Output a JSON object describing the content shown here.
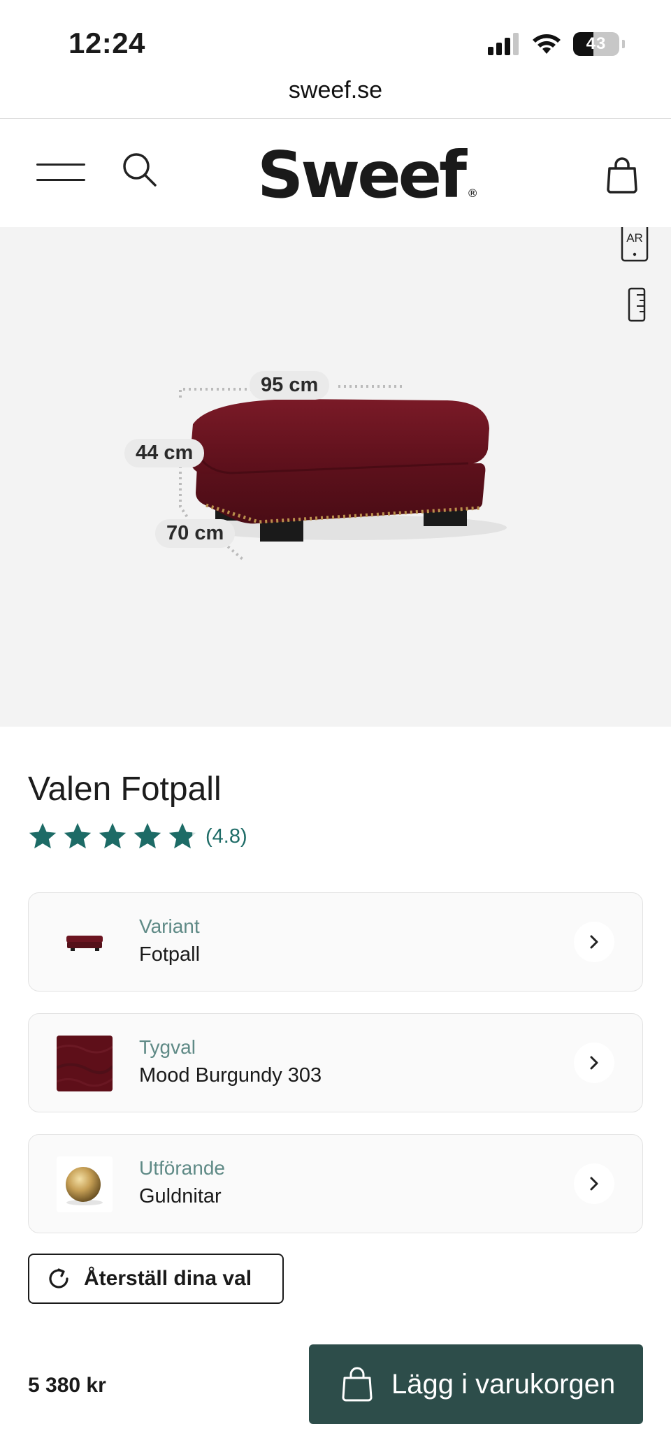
{
  "status_bar": {
    "time": "12:24",
    "battery_level": "43",
    "icons": [
      "signal-icon",
      "wifi-icon",
      "battery-icon"
    ]
  },
  "browser": {
    "url": "sweef.se"
  },
  "header": {
    "logo": "Sweef",
    "logo_mark": "®",
    "icons": [
      "menu-icon",
      "search-icon",
      "cart-icon"
    ]
  },
  "hero": {
    "ar_label": "AR",
    "dimensions": {
      "width": "95 cm",
      "height": "44 cm",
      "depth": "70 cm"
    },
    "colors": {
      "fabric": "#6b1420",
      "background": "#f3f3f3"
    }
  },
  "product": {
    "title": "Valen Fotpall",
    "rating": 4.8,
    "rating_text": "(4.8)",
    "star_color": "#1d6b66"
  },
  "options": [
    {
      "label": "Variant",
      "value": "Fotpall",
      "thumb": "footstool-thumbnail"
    },
    {
      "label": "Tygval",
      "value": "Mood Burgundy 303",
      "thumb": "fabric-swatch"
    },
    {
      "label": "Utförande",
      "value": "Guldnitar",
      "thumb": "gold-stud"
    }
  ],
  "actions": {
    "reset_label": "Återställ dina val",
    "price": "5 380 kr",
    "add_to_cart_label": "Lägg i varukorgen",
    "cta_color": "#2d4d4a"
  }
}
